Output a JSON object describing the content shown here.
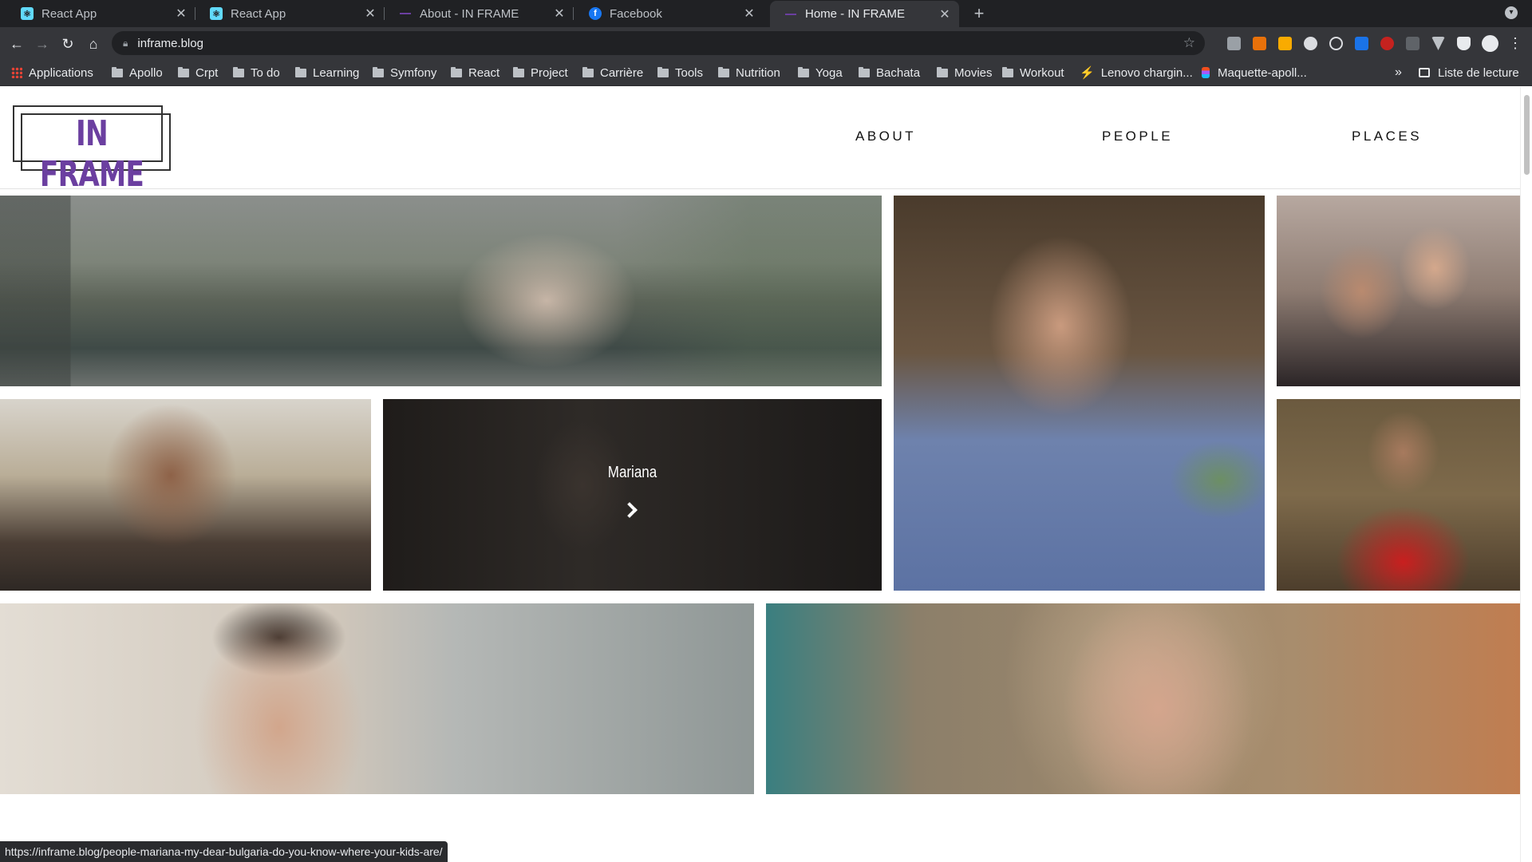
{
  "browser": {
    "tabs": [
      {
        "title": "React App",
        "favicon": "react-icon"
      },
      {
        "title": "React App",
        "favicon": "react-icon"
      },
      {
        "title": "About - IN FRAME",
        "favicon": "inframe-icon"
      },
      {
        "title": "Facebook",
        "favicon": "facebook-icon"
      },
      {
        "title": "Home - IN FRAME",
        "favicon": "inframe-icon",
        "active": true
      }
    ],
    "url": "inframe.blog",
    "bookmarks": [
      "Applications",
      "Apollo",
      "Crpt",
      "To do",
      "Learning",
      "Symfony",
      "React",
      "Project",
      "Carrière",
      "Tools",
      "Nutrition",
      "Yoga",
      "Bachata",
      "Movies",
      "Workout",
      "Lenovo chargin...",
      "Maquette-apoll..."
    ],
    "more_bookmarks": "»",
    "reading_list": "Liste de lecture",
    "status_url": "https://inframe.blog/people-mariana-my-dear-bulgaria-do-you-know-where-your-kids-are/"
  },
  "site": {
    "logo_text": "IN FRAME",
    "nav": [
      "ABOUT",
      "PEOPLE",
      "PLACES"
    ],
    "hover_caption": "Mariana",
    "accent_color": "#6b3fa0"
  }
}
